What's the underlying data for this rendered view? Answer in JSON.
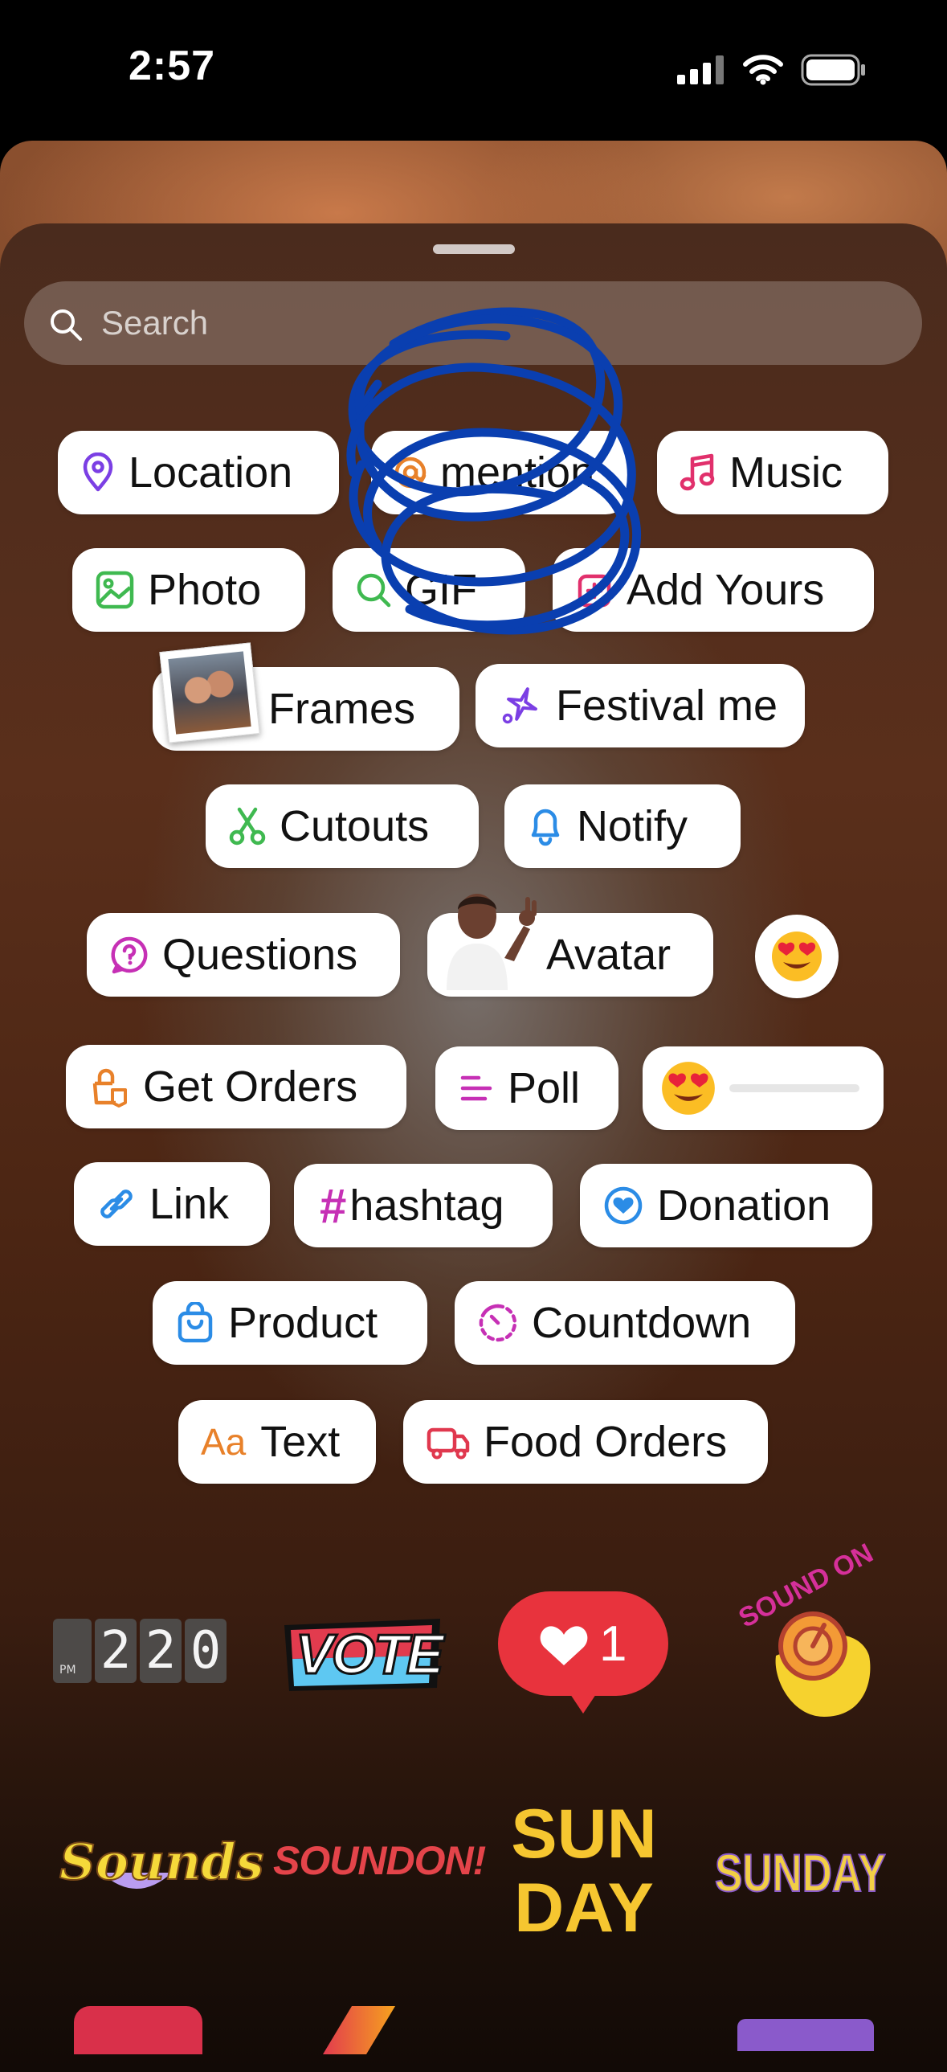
{
  "status_bar": {
    "time": "2:57"
  },
  "search": {
    "placeholder": "Search"
  },
  "stickers": {
    "location": "Location",
    "mention": "mention",
    "music": "Music",
    "photo": "Photo",
    "gif": "GIF",
    "add_yours": "Add Yours",
    "frames": "Frames",
    "festival": "Festival me",
    "cutouts": "Cutouts",
    "notify": "Notify",
    "questions": "Questions",
    "avatar": "Avatar",
    "get_orders": "Get Orders",
    "poll": "Poll",
    "link": "Link",
    "hashtag": "hashtag",
    "donation": "Donation",
    "product": "Product",
    "countdown": "Countdown",
    "text": "Text",
    "text_icon": "Aa",
    "food_orders": "Food Orders"
  },
  "row_stickers": {
    "clock_ampm": "PM",
    "clock_digits": [
      "2",
      "2",
      "0"
    ],
    "vote": "VOTE",
    "like_count": "1",
    "sound_on": "SOUND ON",
    "sounds": "Sounds",
    "sound_on_2": "SOUNDON!",
    "sunday_bubble": "SUNDAY",
    "sunday": "SUNDAY"
  },
  "colors": {
    "location": "#7b3fe4",
    "music": "#e1306c",
    "photo": "#3fb950",
    "cutouts": "#3fb950",
    "notify": "#2b8ce6",
    "question": "#c630b5",
    "orders": "#e8812a",
    "poll": "#c630b5",
    "link": "#2b8ce6",
    "hashtag": "#c630b5",
    "donation": "#2b8ce6",
    "product": "#2b8ce6",
    "countdown": "#c630b5",
    "text_icon": "#e8812a",
    "food": "#e0384e",
    "scribble": "#0a3fb0"
  }
}
